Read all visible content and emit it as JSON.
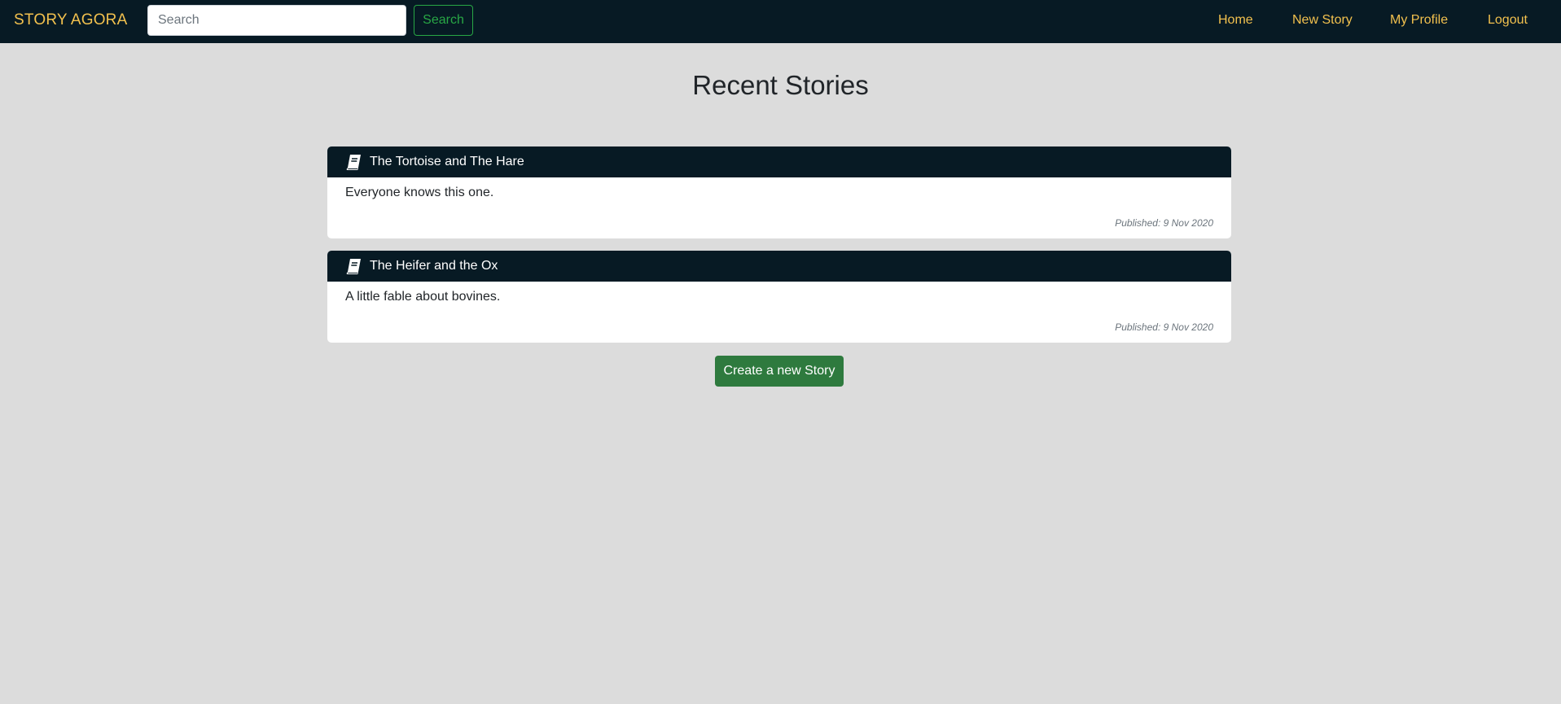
{
  "navbar": {
    "brand": "STORY AGORA",
    "search": {
      "placeholder": "Search",
      "value": ""
    },
    "search_button": "Search",
    "links": [
      "Home",
      "New Story",
      "My Profile",
      "Logout"
    ]
  },
  "main": {
    "title": "Recent Stories",
    "stories": [
      {
        "icon": "book-icon",
        "title": "The Tortoise and The Hare",
        "description": "Everyone knows this one.",
        "published": "Published: 9 Nov 2020"
      },
      {
        "icon": "book-icon",
        "title": "The Heifer and the Ox",
        "description": "A little fable about bovines.",
        "published": "Published: 9 Nov 2020"
      }
    ],
    "create_button": "Create a new Story"
  },
  "colors": {
    "navbar_bg": "#071a24",
    "accent_yellow": "#f2c14e",
    "search_green": "#28a745",
    "create_green": "#2e7a3e",
    "page_bg": "#dcdcdc"
  }
}
